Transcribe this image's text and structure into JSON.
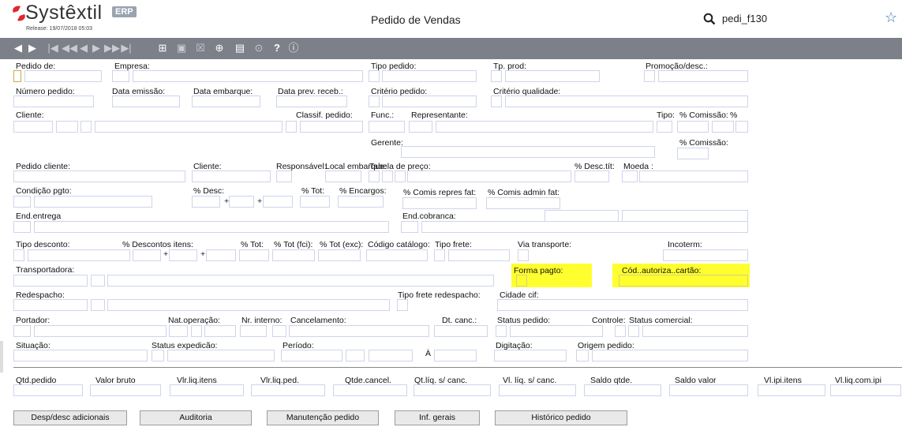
{
  "header": {
    "logo_text": "Systêxtil",
    "logo_badge": "ERP",
    "release": "Release: 19/07/2018 05:03",
    "title": "Pedido de Vendas",
    "search_value": "pedi_f130",
    "accent_color": "#e0262c"
  },
  "toolbar": {
    "icons": [
      "play-prev",
      "play-next",
      "first",
      "prev-page",
      "prev",
      "next",
      "next-page",
      "last",
      "new",
      "save",
      "delete",
      "add",
      "print",
      "zoom",
      "help",
      "info"
    ]
  },
  "labels": {
    "pedido_de": "Pedido de:",
    "empresa": "Empresa:",
    "tipo_pedido": "Tipo pedido:",
    "tp_prod": "Tp. prod:",
    "promocao": "Promoção/desc.:",
    "numero_pedido": "Número pedido:",
    "data_emissao": "Data emissão:",
    "data_embarque": "Data embarque:",
    "data_prev": "Data prev. receb.:",
    "criterio_pedido": "Critério pedido:",
    "criterio_qualidade": "Critério qualidade:",
    "cliente": "Cliente:",
    "classif_pedido": "Classif. pedido:",
    "func": "Func.:",
    "representante": "Representante:",
    "tipo": "Tipo:",
    "pct_comissao": "% Comissão:",
    "pct": "%",
    "gerente": "Gerente:",
    "pct_comissao2": "% Comissão:",
    "pedido_cliente": "Pedido cliente:",
    "cliente2": "Cliente:",
    "responsavel": "Responsável:",
    "local_embarque": "Local embarque:",
    "tabela_preco": "Tabela de preço:",
    "desc_tit": "% Desc.tít:",
    "moeda": "Moeda :",
    "condicao_pgto": "Condição pgto:",
    "pct_desc": "% Desc:",
    "pct_tot": "% Tot:",
    "pct_encargos": "% Encargos:",
    "comis_repres": "% Comis repres fat:",
    "comis_admin": "% Comis admin fat:",
    "plus": "+",
    "end_entrega": "End.entrega",
    "end_cobranca": "End.cobranca:",
    "tipo_desconto": "Tipo desconto:",
    "descontos_itens": "% Descontos itens:",
    "pct_tot2": "% Tot:",
    "pct_tot_fci": "% Tot (fci):",
    "pct_tot_exc": "% Tot (exc):",
    "codigo_catalogo": "Código catálogo:",
    "tipo_frete": "Tipo frete:",
    "via_transporte": "Via transporte:",
    "incoterm": "Incoterm:",
    "transportadora": "Transportadora:",
    "forma_pagto": "Forma pagto:",
    "cod_autoriza": "Cód..autoriza..cartão:",
    "redespacho": "Redespacho:",
    "tipo_frete_redespacho": "Tipo frete redespacho:",
    "cidade_cif": "Cidade cif:",
    "portador": "Portador:",
    "nat_operacao": "Nat.operação:",
    "nr_interno": "Nr. interno:",
    "cancelamento": "Cancelamento:",
    "dt_canc": "Dt. canc.:",
    "status_pedido": "Status pedido:",
    "controle": "Controle:",
    "status_comercial": "Status comercial:",
    "situacao": "Situação:",
    "status_expedicao": "Status expedicão:",
    "periodo": "Período:",
    "a_sym": "À",
    "digitacao": "Digitação:",
    "origem_pedido": "Origem pedido:",
    "qtd_pedido": "Qtd.pedido",
    "valor_bruto": "Valor bruto",
    "vlr_liq_itens": "Vlr.liq.itens",
    "vlr_liq_ped": "Vlr.liq.ped.",
    "qtde_cancel": "Qtde.cancel.",
    "qt_liq_canc": "Qt.líq. s/ canc.",
    "vl_liq_canc": "Vl. líq. s/ canc.",
    "saldo_qtde": "Saldo qtde.",
    "saldo_valor": "Saldo valor",
    "vl_ipi_itens": "Vl.ipi.itens",
    "vl_liq_com_ipi": "Vl.liq.com.ipi"
  },
  "buttons": {
    "desp_desc": "Desp/desc adicionais",
    "auditoria": "Auditoria",
    "manutencao": "Manutenção pedido",
    "inf_gerais": "Inf. gerais",
    "historico": "Histórico pedido"
  },
  "colors": {
    "toolbar_bg": "#7c8189",
    "highlight": "#ffff30",
    "field_border": "#cfd4ea"
  }
}
